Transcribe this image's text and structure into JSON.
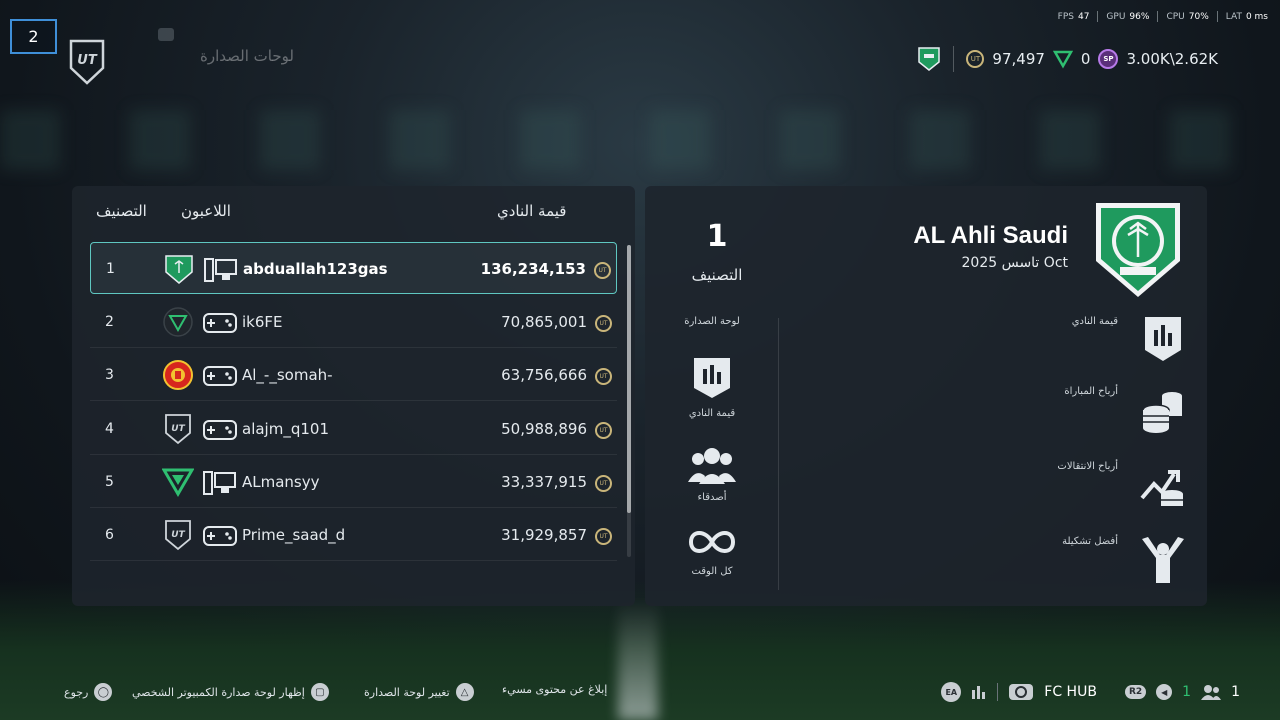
{
  "header": {
    "user_number": "2",
    "title": "لوحات الصدارة"
  },
  "perf": {
    "fps_label": "FPS",
    "fps": "47",
    "gpu_label": "GPU",
    "gpu": "96%",
    "cpu_label": "CPU",
    "cpu": "70%",
    "lat_label": "LAT",
    "lat": "0 ms"
  },
  "currency": {
    "coins": "97,497",
    "points": "0",
    "sp": "3.00K\\2.62K",
    "sp_icon_text": "SP",
    "coin_icon_text": "UT"
  },
  "leaderboard": {
    "col_rank": "التصنيف",
    "col_players": "اللاعبون",
    "col_value": "قيمة النادي",
    "rows": [
      {
        "rank": "1",
        "name": "abduallah123gas",
        "value": "136,234,153",
        "badge": "al-ahli-badge",
        "platform": "pc"
      },
      {
        "rank": "2",
        "name": "ik6FE",
        "value": "70,865,001",
        "badge": "green-shield-badge",
        "platform": "console"
      },
      {
        "rank": "3",
        "name": "Al_-_somah-",
        "value": "63,756,666",
        "badge": "man-utd-badge",
        "platform": "console"
      },
      {
        "rank": "4",
        "name": "alajm_q101",
        "value": "50,988,896",
        "badge": "ut-badge",
        "platform": "console"
      },
      {
        "rank": "5",
        "name": "ALmansyy",
        "value": "33,337,915",
        "badge": "green-v-badge",
        "platform": "pc"
      },
      {
        "rank": "6",
        "name": "Prime_saad_d",
        "value": "31,929,857",
        "badge": "ut-badge",
        "platform": "console"
      }
    ]
  },
  "club": {
    "name": "AL Ahli Saudi",
    "date": "تاسس 2025 Oct",
    "rank": "1",
    "rank_label": "التصنيف",
    "filter_title": "لوحة الصدارة",
    "filters": {
      "club_value": "قيمة النادي",
      "friends": "أصدقاء",
      "all_time": "كل الوقت"
    },
    "stats": {
      "club_value": "قيمة النادي",
      "match_earnings": "أرباح المباراة",
      "transfer_profits": "أرباح الانتقالات",
      "best_squad": "أفضل تشكيلة"
    }
  },
  "footer": {
    "back": "رجوع",
    "show_pc": "إظهار لوحة صدارة الكمبيوتر الشخصي",
    "change": "تغيير لوحة الصدارة",
    "report": "إبلاغ عن محتوى مسيء",
    "hub": "FC HUB",
    "r2_label": "R2",
    "notif_count": "1",
    "friends_count": "1",
    "ea_label": "EA"
  },
  "colors": {
    "accent": "#5fc7c1",
    "coin": "#c9b57a",
    "sp": "#b77ae8",
    "green": "#2fbf71"
  }
}
